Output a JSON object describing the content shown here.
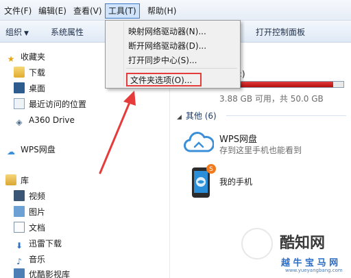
{
  "menubar": {
    "items": [
      {
        "label": "文件(F)"
      },
      {
        "label": "编辑(E)"
      },
      {
        "label": "查看(V)"
      },
      {
        "label": "工具(T)"
      },
      {
        "label": "帮助(H)"
      }
    ]
  },
  "toolbar": {
    "organize": "组织",
    "system_properties": "系统属性",
    "open_control_panel": "打开控制面板"
  },
  "tools_menu": {
    "items": [
      {
        "label": "映射网络驱动器(N)..."
      },
      {
        "label": "断开网络驱动器(D)..."
      },
      {
        "label": "打开同步中心(S)..."
      },
      {
        "label": "文件夹选项(O)..."
      }
    ],
    "highlight_color": "#e53b3b"
  },
  "nav": {
    "favorites": {
      "label": "收藏夹",
      "icon": "star-icon"
    },
    "favorites_items": [
      {
        "label": "下载",
        "icon": "download-folder-icon"
      },
      {
        "label": "桌面",
        "icon": "desktop-icon"
      },
      {
        "label": "最近访问的位置",
        "icon": "recent-places-icon"
      },
      {
        "label": "A360 Drive",
        "icon": "a360-icon"
      }
    ],
    "wps_cloud": {
      "label": "WPS网盘",
      "icon": "cloud-icon"
    },
    "libraries": {
      "label": "库",
      "icon": "library-icon"
    },
    "library_items": [
      {
        "label": "视频",
        "icon": "video-icon"
      },
      {
        "label": "图片",
        "icon": "picture-icon"
      },
      {
        "label": "文档",
        "icon": "document-icon"
      },
      {
        "label": "迅雷下载",
        "icon": "thunder-download-icon"
      },
      {
        "label": "音乐",
        "icon": "music-icon"
      },
      {
        "label": "优酷影视库",
        "icon": "youku-video-icon"
      }
    ]
  },
  "content": {
    "drive": {
      "label": "盘 (C:)",
      "info": "3.88 GB 可用，共 50.0 GB",
      "used_fraction": 0.92,
      "bar_color": "#d42323"
    },
    "group": {
      "label": "其他 (6)"
    },
    "wps": {
      "title": "WPS网盘",
      "subtitle": "存到这里手机也能看到"
    },
    "phone": {
      "label": "我的手机"
    }
  },
  "watermark": {
    "name": "酷知网",
    "name2": "越 牛 宝 马 网",
    "url": "www.yueyangbang.com"
  },
  "colors": {
    "accent": "#3c78c8",
    "arrow": "#e53b3b"
  }
}
